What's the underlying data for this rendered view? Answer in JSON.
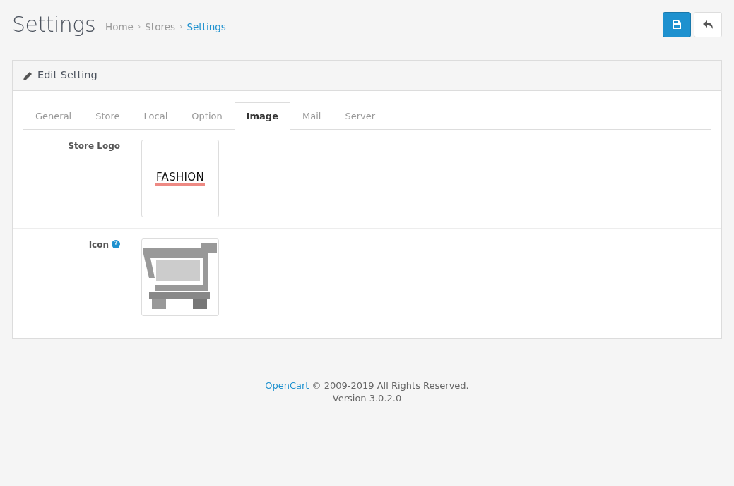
{
  "page_title": "Settings",
  "breadcrumb": [
    {
      "label": "Home",
      "selected": false
    },
    {
      "label": "Stores",
      "selected": false
    },
    {
      "label": "Settings",
      "selected": true
    }
  ],
  "breadcrumb_separator": "›",
  "panel": {
    "title": "Edit Setting"
  },
  "tabs": [
    {
      "label": "General",
      "selected": false
    },
    {
      "label": "Store",
      "selected": false
    },
    {
      "label": "Local",
      "selected": false
    },
    {
      "label": "Option",
      "selected": false
    },
    {
      "label": "Image",
      "selected": true
    },
    {
      "label": "Mail",
      "selected": false
    },
    {
      "label": "Server",
      "selected": false
    }
  ],
  "fields": [
    {
      "label": "Store Logo",
      "kind": "logo",
      "logo_text": "FASHION"
    },
    {
      "label": "Icon",
      "help_mark": "?",
      "kind": "cart"
    }
  ],
  "footer": {
    "brand": "OpenCart",
    "copyright": " © 2009-2019 All Rights Reserved.",
    "version": "Version 3.0.2.0"
  }
}
